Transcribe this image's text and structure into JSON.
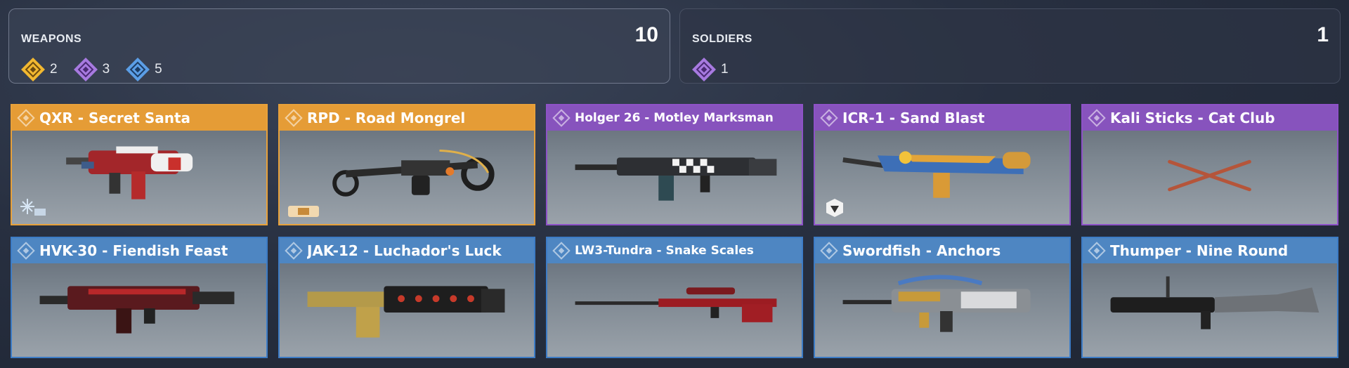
{
  "weapons_summary": {
    "title": "WEAPONS",
    "total": "10",
    "rarities": [
      {
        "rarity": "legendary",
        "icon": "legendary-rarity-icon",
        "color": "#f2b830",
        "count": "2"
      },
      {
        "rarity": "epic",
        "icon": "epic-rarity-icon",
        "color": "#a77ae0",
        "count": "3"
      },
      {
        "rarity": "rare",
        "icon": "rare-rarity-icon",
        "color": "#5b9ee6",
        "count": "5"
      }
    ]
  },
  "soldiers_summary": {
    "title": "SOLDIERS",
    "total": "1",
    "rarities": [
      {
        "rarity": "epic",
        "icon": "epic-rarity-icon",
        "color": "#a77ae0",
        "count": "1"
      }
    ]
  },
  "colors": {
    "legendary": "#e59c36",
    "epic": "#8753bd",
    "rare": "#4e86c2"
  },
  "cards": [
    {
      "name": "QXR - Secret Santa",
      "rarity": "legendary",
      "icon": "smg-weapon-icon",
      "badge": "snowflake-badge-icon"
    },
    {
      "name": "RPD - Road Mongrel",
      "rarity": "legendary",
      "icon": "lmg-weapon-icon",
      "badge": "ammo-badge-icon"
    },
    {
      "name": "Holger 26 - Motley Marksman",
      "rarity": "epic",
      "icon": "assault-rifle-weapon-icon"
    },
    {
      "name": "ICR-1 - Sand Blast",
      "rarity": "epic",
      "icon": "assault-rifle-weapon-icon",
      "badge": "emblem-badge-icon"
    },
    {
      "name": "Kali Sticks - Cat Club",
      "rarity": "epic",
      "icon": "melee-sticks-icon"
    },
    {
      "name": "HVK-30 - Fiendish Feast",
      "rarity": "rare",
      "icon": "assault-rifle-weapon-icon"
    },
    {
      "name": "JAK-12 - Luchador's Luck",
      "rarity": "rare",
      "icon": "shotgun-weapon-icon"
    },
    {
      "name": "LW3-Tundra - Snake Scales",
      "rarity": "rare",
      "icon": "sniper-weapon-icon"
    },
    {
      "name": "Swordfish - Anchors",
      "rarity": "rare",
      "icon": "burst-rifle-weapon-icon"
    },
    {
      "name": "Thumper - Nine Round",
      "rarity": "rare",
      "icon": "launcher-weapon-icon"
    }
  ]
}
